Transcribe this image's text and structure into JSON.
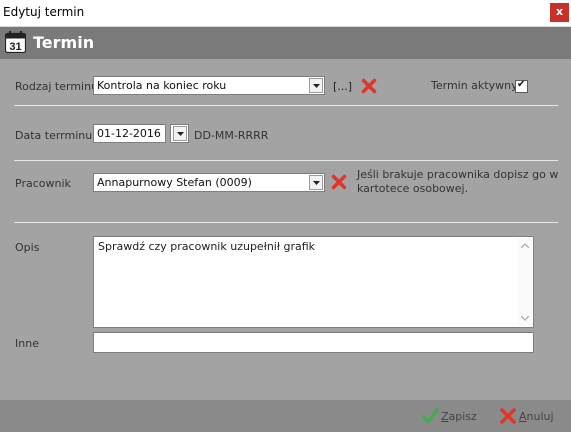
{
  "window": {
    "title": "Edytuj termin",
    "close_label": "x"
  },
  "header": {
    "title": "Termin",
    "calendar_day": "31"
  },
  "form": {
    "rodzaj": {
      "label": "Rodzaj terminu",
      "value": "Kontrola na koniec roku",
      "browse_label": "[...]"
    },
    "aktywny": {
      "label": "Termin aktywny",
      "checked": true,
      "check_glyph": "✔"
    },
    "data": {
      "label": "Data terrminu",
      "value": "01-12-2016",
      "format_hint": "DD-MM-RRRR"
    },
    "pracownik": {
      "label": "Pracownik",
      "value": "Annapurnowy Stefan (0009)",
      "hint_line1": "Jeśli brakuje pracownika dopisz go w",
      "hint_line2": "kartotece osobowej."
    },
    "opis": {
      "label": "Opis",
      "value": "Sprawdź czy pracownik uzupełnił grafik"
    },
    "inne": {
      "label": "Inne",
      "value": ""
    }
  },
  "footer": {
    "save_first": "Z",
    "save_rest": "apisz",
    "cancel_first": "A",
    "cancel_rest": "nuluj"
  },
  "colors": {
    "accent_green": "#3fae49",
    "delete_red": "#e0352b",
    "header_bg": "#7a7a7a"
  }
}
